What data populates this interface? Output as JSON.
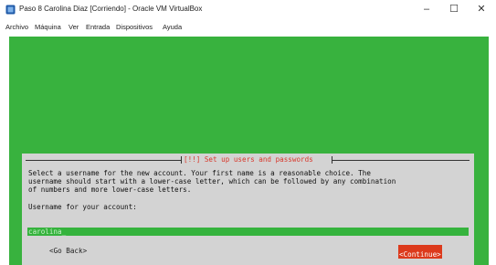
{
  "window": {
    "title": "Paso 8 Carolina Diaz [Corriendo] - Oracle VM VirtualBox",
    "minimize": "–",
    "maximize": "☐",
    "close": "✕"
  },
  "menu": [
    "Archivo",
    "Máquina",
    "Ver",
    "Entrada",
    "Dispositivos",
    "Ayuda"
  ],
  "installer": {
    "dialog_title": "[!!] Set up users and passwords",
    "description": [
      "Select a username for the new account. Your first name is a reasonable choice. The",
      "username should start with a lower-case letter, which can be followed by any combination",
      "of numbers and more lower-case letters."
    ],
    "prompt": "Username for your account:",
    "username_value": "carolina_",
    "back_label": "<Go Back>",
    "continue_label": "<Continue>"
  },
  "colors": {
    "vm_background": "#38b23e",
    "dialog_background": "#d3d3d3",
    "accent_red": "#dc3a1c"
  }
}
